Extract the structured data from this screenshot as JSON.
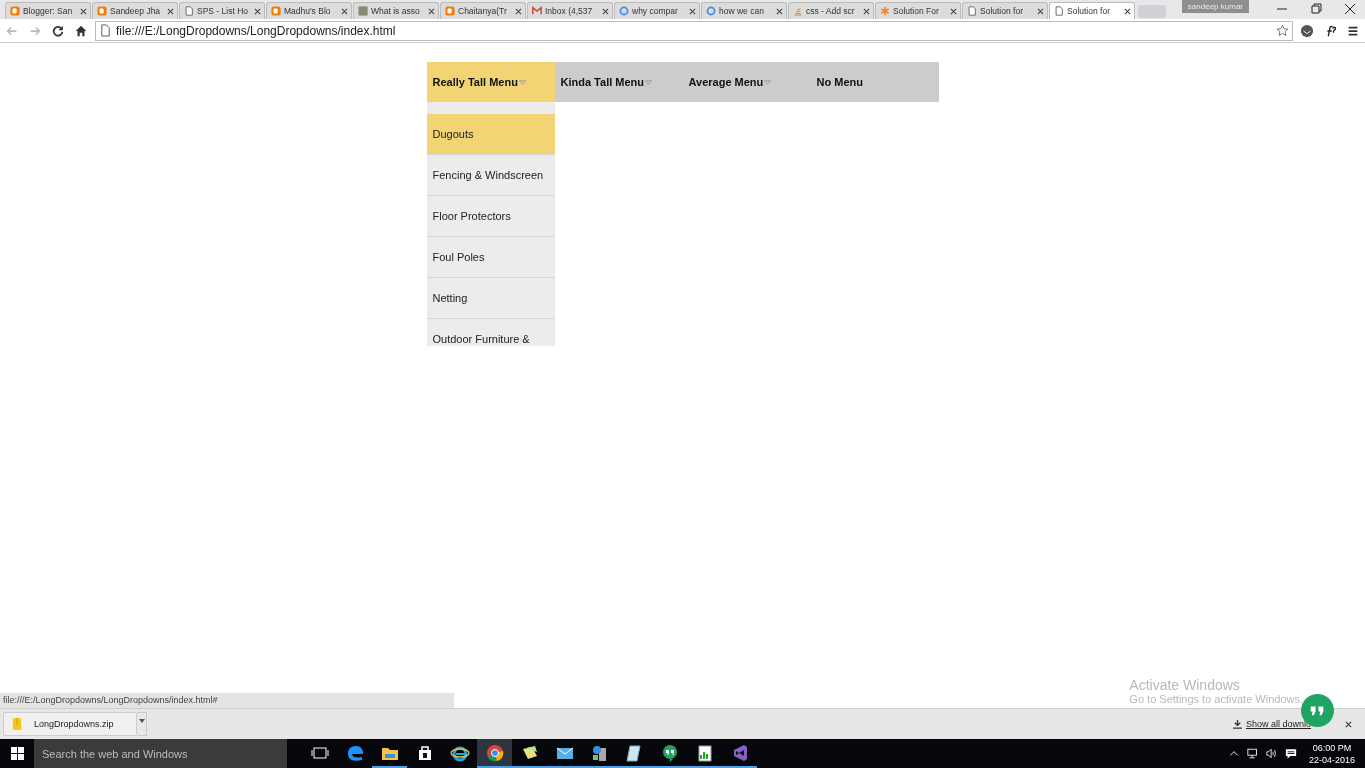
{
  "browser": {
    "tabs": [
      {
        "title": "Blogger: San",
        "kind": "blogger",
        "selected": false
      },
      {
        "title": "Sandeep Jha",
        "kind": "blogger",
        "selected": false
      },
      {
        "title": "SPS - List Ho",
        "kind": "page",
        "selected": false
      },
      {
        "title": "Madhu's Blo",
        "kind": "blogger",
        "selected": false
      },
      {
        "title": "What is asso",
        "kind": "badge",
        "selected": false
      },
      {
        "title": "Chaitanya(Tr",
        "kind": "blogger",
        "selected": false
      },
      {
        "title": "Inbox (4,537",
        "kind": "mail",
        "selected": false
      },
      {
        "title": "why compar",
        "kind": "google",
        "selected": false
      },
      {
        "title": "how we can",
        "kind": "google",
        "selected": false
      },
      {
        "title": "css - Add scr",
        "kind": "stack",
        "selected": false
      },
      {
        "title": "Solution For",
        "kind": "star",
        "selected": false
      },
      {
        "title": "Solution for",
        "kind": "page",
        "selected": false
      },
      {
        "title": "Solution for",
        "kind": "page",
        "selected": true
      }
    ],
    "user": "sandeep kumar",
    "address": "file:///E:/LongDropdowns/LongDropdowns/index.html"
  },
  "menu": {
    "items": [
      {
        "label": "Really Tall Menu",
        "has_dropdown": true,
        "selected": true
      },
      {
        "label": "Kinda Tall Menu",
        "has_dropdown": true,
        "selected": false
      },
      {
        "label": "Average Menu",
        "has_dropdown": true,
        "selected": false
      },
      {
        "label": "No Menu",
        "has_dropdown": false,
        "selected": false
      }
    ],
    "dropdown": [
      {
        "label": "Dugouts",
        "selected": true
      },
      {
        "label": "Fencing & Windscreen",
        "selected": false
      },
      {
        "label": "Floor Protectors",
        "selected": false
      },
      {
        "label": "Foul Poles",
        "selected": false
      },
      {
        "label": "Netting",
        "selected": false
      },
      {
        "label": "Outdoor Furniture &",
        "selected": false
      }
    ]
  },
  "status_url": "file:///E:/LongDropdowns/LongDropdowns/index.html#",
  "activation": {
    "title": "Activate Windows",
    "subtitle": "Go to Settings to activate Windows."
  },
  "downloads": {
    "file": "LongDropdowns.zip",
    "show_all": "Show all downlo"
  },
  "taskbar": {
    "search_placeholder": "Search the web and Windows",
    "apps": [
      {
        "kind": "taskview",
        "running": false,
        "selected": false
      },
      {
        "kind": "edge",
        "running": false,
        "selected": false
      },
      {
        "kind": "folder",
        "running": true,
        "selected": false
      },
      {
        "kind": "store",
        "running": false,
        "selected": false
      },
      {
        "kind": "ie",
        "running": false,
        "selected": false
      },
      {
        "kind": "chrome",
        "running": true,
        "selected": true
      },
      {
        "kind": "notes",
        "running": true,
        "selected": false
      },
      {
        "kind": "mail",
        "running": true,
        "selected": false
      },
      {
        "kind": "server",
        "running": true,
        "selected": false
      },
      {
        "kind": "notepad",
        "running": true,
        "selected": false
      },
      {
        "kind": "hangouts",
        "running": true,
        "selected": false
      },
      {
        "kind": "chart",
        "running": true,
        "selected": false
      },
      {
        "kind": "studio",
        "running": true,
        "selected": false
      }
    ],
    "time": "06:00 PM",
    "date": "22-04-2016"
  }
}
